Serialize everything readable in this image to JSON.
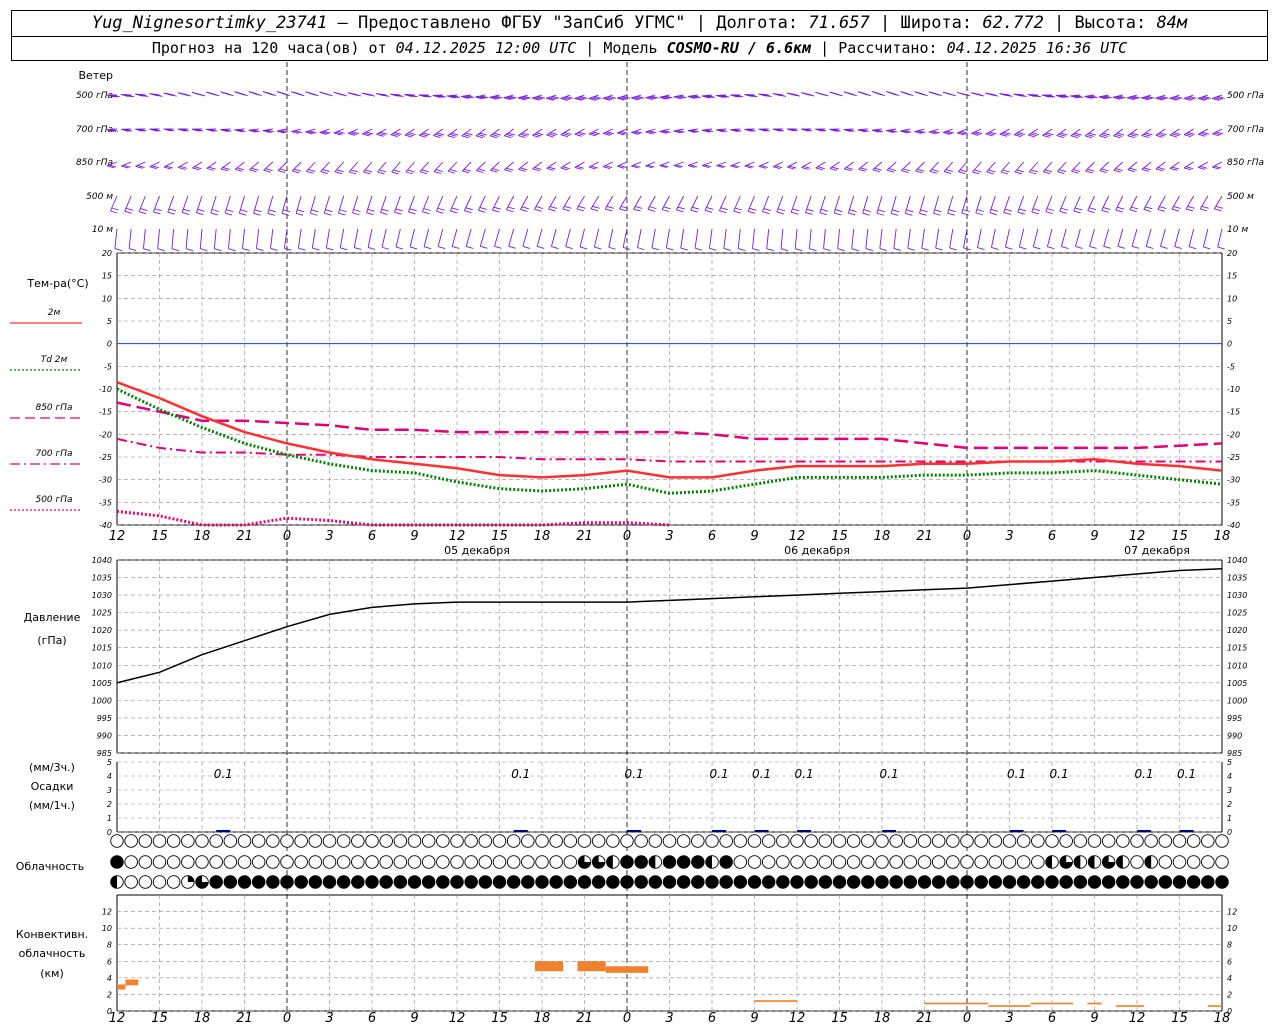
{
  "header": {
    "station": "Yug_Nignesortimky_23741",
    "provider": "— Предоставлено ФГБУ \"ЗапСиб УГМС\"",
    "lon_label": "Долгота:",
    "lon_value": "71.657",
    "lat_label": "Широта:",
    "lat_value": "62.772",
    "alt_label": "Высота:",
    "alt_value": "84м",
    "forecast_text": "Прогноз на 120 часа(ов) от",
    "forecast_start": "04.12.2025 12:00 UTC",
    "model_label": "Модель",
    "model_name": "COSMO-RU / 6.6км",
    "calc_label": "Рассчитано:",
    "calc_value": "04.12.2025 16:36 UTC"
  },
  "colors": {
    "t2m": "#ff3030",
    "td2m": "#008000",
    "t850": "#e0007a",
    "t700": "#e0007a",
    "t500": "#e0007a",
    "wind": "#7b19d9",
    "pressure": "#000000",
    "zero": "#1a3cff",
    "precip": "#000080",
    "convective": "#f0822d",
    "grid": "#8c8c8c"
  },
  "time_axis": {
    "ticks": [
      "12",
      "15",
      "18",
      "21",
      "0",
      "3",
      "6",
      "9",
      "12",
      "15",
      "18",
      "21",
      "0",
      "3",
      "6",
      "9",
      "12",
      "15",
      "18",
      "21",
      "0",
      "3",
      "6",
      "9",
      "12",
      "15",
      "18"
    ],
    "dates": [
      "05 декабря",
      "06 декабря",
      "07 декабря"
    ],
    "midnight_ticks": [
      4,
      12,
      20
    ]
  },
  "wind": {
    "title": "Ветер",
    "levels": [
      "500 гПа",
      "700 гПа",
      "850 гПа",
      "500 м",
      "10 м"
    ],
    "right_levels": [
      "500 гПа",
      "700 гПа",
      "850 гПа",
      "500 м",
      "10 м"
    ],
    "direction_deg": [
      270,
      260,
      250,
      220,
      200
    ],
    "speed_ms": [
      22,
      17,
      12,
      8,
      4
    ]
  },
  "temperature": {
    "title": "Тем-ра(°С)",
    "legend": [
      {
        "label": "2м",
        "style": "solid"
      },
      {
        "label": "Td 2м",
        "style": "dotted"
      },
      {
        "label": "850 гПа",
        "style": "dashed"
      },
      {
        "label": "700 гПа",
        "style": "dashdot"
      },
      {
        "label": "500 гПа",
        "style": "dotted"
      }
    ],
    "ylim": [
      -40,
      20
    ],
    "yticks": [
      20,
      15,
      10,
      5,
      0,
      -5,
      -10,
      -15,
      -20,
      -25,
      -30,
      -35,
      -40
    ],
    "hours": [
      0,
      3,
      6,
      9,
      12,
      15,
      18,
      21,
      24,
      27,
      30,
      33,
      36,
      39,
      42,
      45,
      48,
      51,
      54,
      57,
      60,
      63,
      66,
      69,
      72,
      75,
      78
    ],
    "t2m": [
      -8.5,
      -12,
      -16,
      -19.5,
      -22,
      -24,
      -25.5,
      -26.5,
      -27.5,
      -29,
      -29.5,
      -29,
      -28,
      -29.5,
      -29.5,
      -28,
      -27,
      -27,
      -27,
      -26.5,
      -26.5,
      -26,
      -26,
      -25.5,
      -26.5,
      -27,
      -28
    ],
    "td2m": [
      -10,
      -14.5,
      -18.5,
      -22,
      -24.5,
      -26.5,
      -28,
      -28.5,
      -30.5,
      -32,
      -32.5,
      -32,
      -31,
      -33,
      -32.5,
      -31,
      -29.5,
      -29.5,
      -29.5,
      -29,
      -29,
      -28.5,
      -28.5,
      -28,
      -29,
      -30,
      -31
    ],
    "t850": [
      -13,
      -15,
      -17,
      -17,
      -17.5,
      -18,
      -19,
      -19,
      -19.5,
      -19.5,
      -19.5,
      -19.5,
      -19.5,
      -19.5,
      -20,
      -21,
      -21,
      -21,
      -21,
      -22,
      -23,
      -23,
      -23,
      -23,
      -23,
      -22.5,
      -22
    ],
    "t700": [
      -21,
      -23,
      -24,
      -24,
      -24.5,
      -24.5,
      -25,
      -25,
      -25,
      -25,
      -25.5,
      -25.5,
      -25.5,
      -26,
      -26,
      -26,
      -26,
      -26,
      -26,
      -26,
      -26,
      -26,
      -26,
      -26,
      -26,
      -26,
      -26
    ],
    "t500": [
      -37,
      -38,
      -40,
      -40,
      -38.5,
      -39,
      -40,
      -40,
      -40,
      -40,
      -40,
      -39.5,
      -39.5,
      -40,
      null,
      null,
      null,
      null,
      null,
      null,
      null,
      null,
      null,
      null,
      null,
      null,
      null
    ]
  },
  "pressure": {
    "title": "Давление",
    "unit": "(гПа)",
    "ylim": [
      985,
      1040
    ],
    "yticks": [
      1040,
      1035,
      1030,
      1025,
      1020,
      1015,
      1010,
      1005,
      1000,
      995,
      990,
      985
    ],
    "values": [
      1005,
      1008,
      1013,
      1017,
      1021,
      1024.5,
      1026.5,
      1027.5,
      1028,
      1028,
      1028,
      1028,
      1028,
      1028.5,
      1029,
      1029.5,
      1030,
      1030.5,
      1031,
      1031.5,
      1032,
      1033,
      1034,
      1035,
      1036,
      1037,
      1037.5
    ]
  },
  "precip": {
    "title1": "(мм/3ч.)",
    "title2": "Осадки",
    "title3": "(мм/1ч.)",
    "ylim": [
      0,
      5
    ],
    "yticks": [
      5,
      4,
      3,
      2,
      1,
      0
    ],
    "labels": [
      {
        "hour": 7.5,
        "text": "0.1"
      },
      {
        "hour": 28.5,
        "text": "0.1"
      },
      {
        "hour": 36.5,
        "text": "0.1"
      },
      {
        "hour": 42.5,
        "text": "0.1"
      },
      {
        "hour": 45.5,
        "text": "0.1"
      },
      {
        "hour": 48.5,
        "text": "0.1"
      },
      {
        "hour": 54.5,
        "text": "0.1"
      },
      {
        "hour": 63.5,
        "text": "0.1"
      },
      {
        "hour": 66.5,
        "text": "0.1"
      },
      {
        "hour": 72.5,
        "text": "0.1"
      },
      {
        "hour": 75.5,
        "text": "0.1"
      }
    ]
  },
  "cloud": {
    "title": "Облачность",
    "rows": [
      "0000000000000000000000000000000000000000000000000000000000000000000000000000000",
      "4000000000000000000000000000000003324424442400000000000000000000002322320200000",
      "2000013444444444444444444444444444444444444444444444444444444444444444444444444"
    ]
  },
  "convective": {
    "title1": "Конвективн.",
    "title2": "облачность",
    "title3": "(км)",
    "ylim": [
      0,
      14
    ],
    "yticks": [
      12,
      10,
      8,
      6,
      4,
      2,
      0
    ],
    "segments": [
      {
        "h0": 0,
        "h1": 0.6,
        "bottom": 2.6,
        "top": 3.2
      },
      {
        "h0": 0.6,
        "h1": 1.5,
        "bottom": 3.1,
        "top": 3.8
      },
      {
        "h0": 29.5,
        "h1": 31.5,
        "bottom": 4.8,
        "top": 6.0
      },
      {
        "h0": 32.5,
        "h1": 34.5,
        "bottom": 4.8,
        "top": 6.0
      },
      {
        "h0": 34.5,
        "h1": 37.5,
        "bottom": 4.6,
        "top": 5.4
      },
      {
        "h0": 45,
        "h1": 48,
        "bottom": 1.1,
        "top": 1.3
      },
      {
        "h0": 57,
        "h1": 61.5,
        "bottom": 0.8,
        "top": 1.0
      },
      {
        "h0": 61.5,
        "h1": 64.5,
        "bottom": 0.5,
        "top": 0.7
      },
      {
        "h0": 64.5,
        "h1": 67.5,
        "bottom": 0.8,
        "top": 1.0
      },
      {
        "h0": 68.5,
        "h1": 69.5,
        "bottom": 0.8,
        "top": 1.0
      },
      {
        "h0": 70.5,
        "h1": 72.5,
        "bottom": 0.5,
        "top": 0.7
      },
      {
        "h0": 77,
        "h1": 78,
        "bottom": 0.5,
        "top": 0.7
      }
    ]
  }
}
